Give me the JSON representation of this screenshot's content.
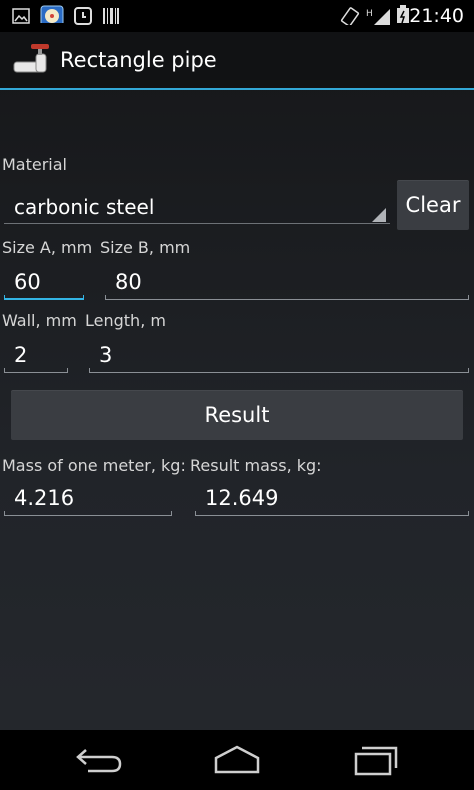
{
  "status_bar": {
    "time": "21:40",
    "icons": [
      "image-icon",
      "app-icon",
      "clock-icon",
      "barcode-icon",
      "rotate-icon",
      "signal-icon",
      "battery-icon"
    ],
    "network_label": "H"
  },
  "action_bar": {
    "title": "Rectangle pipe",
    "app_icon": "pipe-icon",
    "accent_color": "#33a8d6"
  },
  "form": {
    "material": {
      "label": "Material",
      "value": "carbonic steel"
    },
    "clear_label": "Clear",
    "size_a": {
      "label": "Size A, mm",
      "value": "60"
    },
    "size_b": {
      "label": "Size B, mm",
      "value": "80"
    },
    "wall": {
      "label": "Wall, mm",
      "value": "2"
    },
    "length": {
      "label": "Length, m",
      "value": "3"
    },
    "result_label": "Result",
    "mass_per_meter": {
      "label": "Mass of one meter, kg:",
      "value": "4.216"
    },
    "result_mass": {
      "label": "Result mass, kg:",
      "value": "12.649"
    }
  },
  "nav_bar": {
    "buttons": [
      "back-icon",
      "home-icon",
      "recent-apps-icon"
    ]
  }
}
